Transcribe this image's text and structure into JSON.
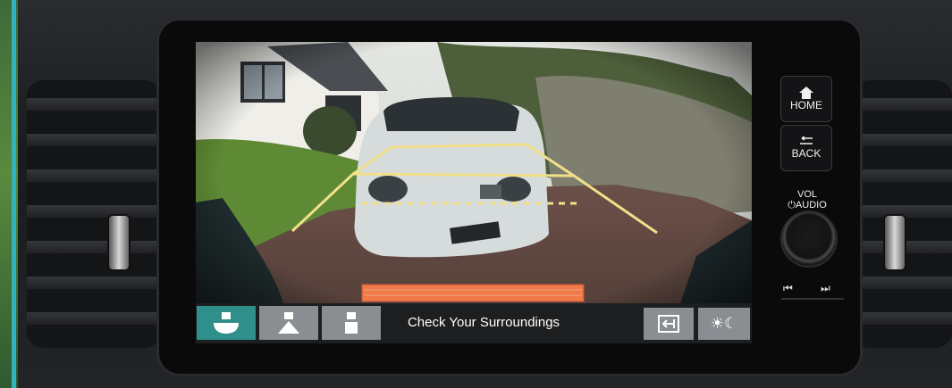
{
  "screen": {
    "status_text": "Check Your Surroundings",
    "view_modes": [
      {
        "icon": "wide-view-icon",
        "active": true
      },
      {
        "icon": "normal-view-icon",
        "active": false
      },
      {
        "icon": "top-down-view-icon",
        "active": false
      }
    ],
    "exit_icon": "exit-icon",
    "day_night_icon": "day-night-icon",
    "day_night_glyph": "☀☾"
  },
  "hard_keys": {
    "home_label": "HOME",
    "back_label": "BACK",
    "vol_label": "VOL",
    "audio_label": "AUDIO",
    "power_glyph": "⏻",
    "prev_glyph": "⏮",
    "next_glyph": "⏭"
  },
  "colors": {
    "guide_line": "#f2e08a",
    "warning_bar": "#f07a4a",
    "active_view": "#2f8f8a",
    "button_grey": "#8a8d91"
  }
}
